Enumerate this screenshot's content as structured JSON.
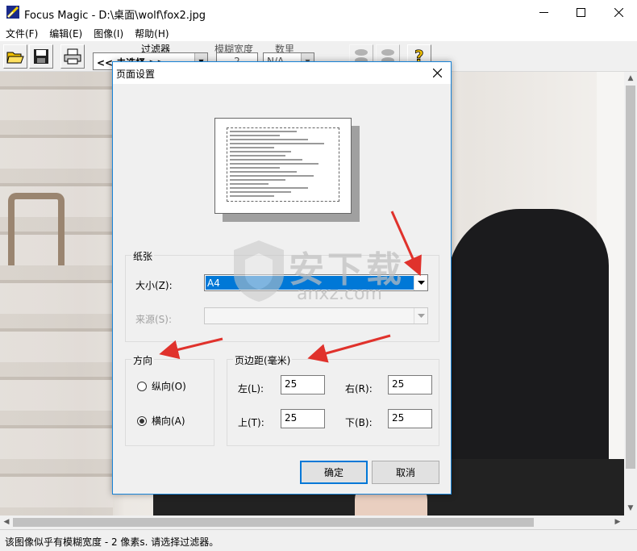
{
  "window": {
    "title": "Focus Magic - D:\\桌面\\wolf\\fox2.jpg"
  },
  "menu": [
    "文件(F)",
    "编辑(E)",
    "图像(I)",
    "帮助(H)"
  ],
  "toolbar": {
    "filter_label": "过滤器",
    "filter_value": "<< 未选择 >>",
    "blur_width_label": "模糊宽度",
    "blur_width_value": "2",
    "amount_label": "数里",
    "amount_value": "N/A"
  },
  "dialog": {
    "title": "页面设置",
    "paper_group": "纸张",
    "size_label": "大小(Z):",
    "size_value": "A4",
    "source_label": "来源(S):",
    "source_value": "",
    "orientation_group": "方向",
    "portrait_label": "纵向(O)",
    "landscape_label": "横向(A)",
    "orientation_selected": "landscape",
    "margins_group": "页边距(毫米)",
    "left_label": "左(L):",
    "left_value": "25",
    "right_label": "右(R):",
    "right_value": "25",
    "top_label": "上(T):",
    "top_value": "25",
    "bottom_label": "下(B):",
    "bottom_value": "25",
    "ok_label": "确定",
    "cancel_label": "取消"
  },
  "status": {
    "text": "该图像似乎有模糊宽度 - 2 像素s.    请选择过滤器。"
  },
  "watermark": {
    "text": "安下载",
    "sub": "anxz.com"
  },
  "colors": {
    "accent": "#0078d7",
    "arrow": "#e0322c"
  }
}
